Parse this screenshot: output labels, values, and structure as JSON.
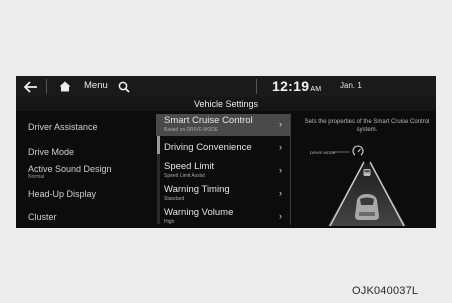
{
  "status_bar": {
    "menu_label": "Menu",
    "time": "12:19",
    "ampm": "AM",
    "date": "Jan. 1"
  },
  "page_title": "Vehicle Settings",
  "left_menu": [
    {
      "label": "Driver Assistance",
      "sub": ""
    },
    {
      "label": "Drive Mode",
      "sub": ""
    },
    {
      "label": "Active Sound Design",
      "sub": "Normal"
    },
    {
      "label": "Head-Up Display",
      "sub": ""
    },
    {
      "label": "Cluster",
      "sub": ""
    }
  ],
  "sub_menu": [
    {
      "label": "Smart Cruise Control",
      "sub": "Based on DRIVE MODE",
      "selected": true
    },
    {
      "label": "Driving Convenience",
      "sub": "",
      "selected": false
    },
    {
      "label": "Speed Limit",
      "sub": "Speed Limit Assist",
      "selected": false
    },
    {
      "label": "Warning Timing",
      "sub": "Standard",
      "selected": false
    },
    {
      "label": "Warning Volume",
      "sub": "High",
      "selected": false
    }
  ],
  "description": "Sets the properties of the Smart Cruise Control system.",
  "illustration": {
    "mode_text": "DRIVE MODE"
  },
  "caption": "OJK040037L",
  "icons": [
    "back-arrow-icon",
    "home-icon",
    "search-icon",
    "chevron-right-icon",
    "cruise-control-icon",
    "car-icon"
  ]
}
